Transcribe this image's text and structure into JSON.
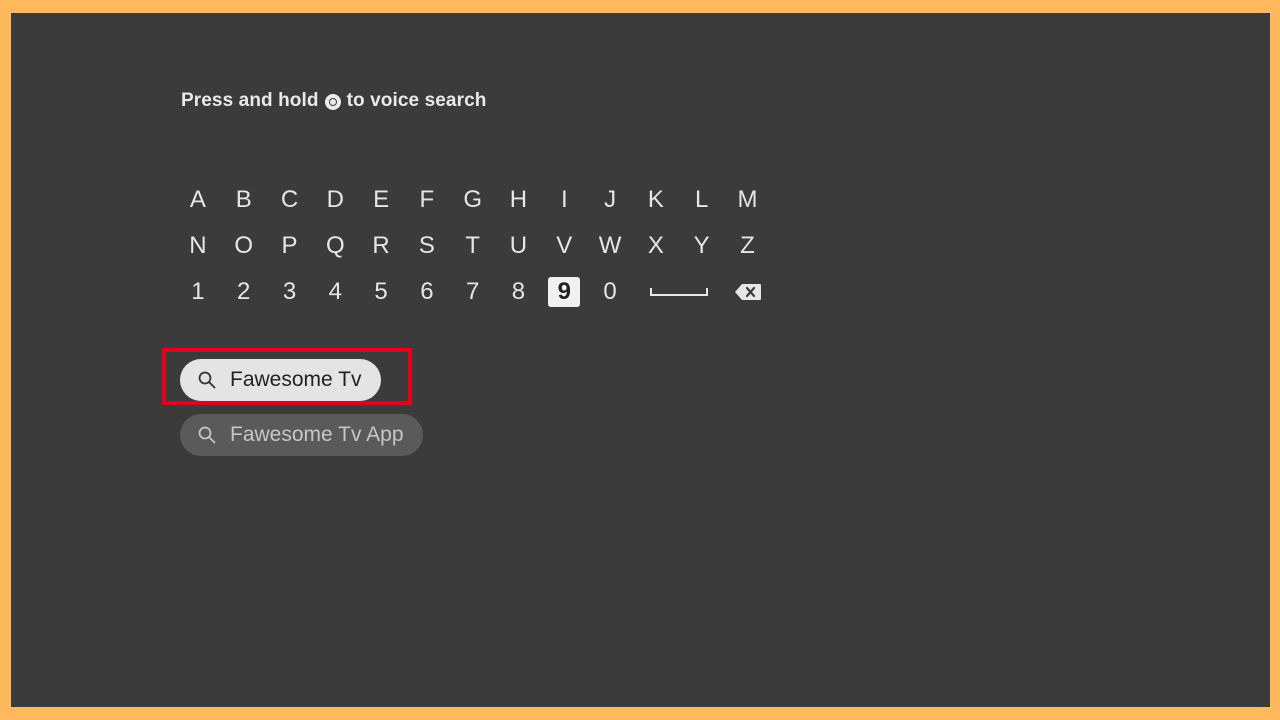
{
  "voice_hint": {
    "before": "Press and hold",
    "after": "to voice search",
    "icon": "microphone-button-icon"
  },
  "keyboard": {
    "rows": [
      [
        "A",
        "B",
        "C",
        "D",
        "E",
        "F",
        "G",
        "H",
        "I",
        "J",
        "K",
        "L",
        "M"
      ],
      [
        "N",
        "O",
        "P",
        "Q",
        "R",
        "S",
        "T",
        "U",
        "V",
        "W",
        "X",
        "Y",
        "Z"
      ],
      [
        "1",
        "2",
        "3",
        "4",
        "5",
        "6",
        "7",
        "8",
        "9",
        "0"
      ]
    ],
    "selected_key": "9",
    "space_icon": "space-bar-icon",
    "backspace_icon": "backspace-icon"
  },
  "suggestions": [
    {
      "label": "Fawesome Tv",
      "icon": "search-icon",
      "active": true
    },
    {
      "label": "Fawesome Tv App",
      "icon": "search-icon",
      "active": false
    }
  ],
  "colors": {
    "background": "#3b3b3b",
    "border": "#ffb95c",
    "highlight": "#e4001b",
    "selected_bg": "#f1f1f1"
  }
}
